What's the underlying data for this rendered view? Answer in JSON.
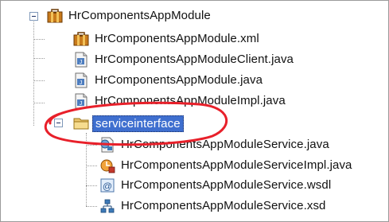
{
  "tree": {
    "root": {
      "label": "HrComponentsAppModule",
      "icon": "application-module-icon",
      "children": [
        {
          "label": "HrComponentsAppModule.xml",
          "icon": "application-module-icon"
        },
        {
          "label": "HrComponentsAppModuleClient.java",
          "icon": "java-file-icon"
        },
        {
          "label": "HrComponentsAppModule.java",
          "icon": "java-file-icon"
        },
        {
          "label": "HrComponentsAppModuleImpl.java",
          "icon": "java-file-icon"
        }
      ]
    },
    "folder": {
      "label": "serviceinterface",
      "icon": "folder-open-icon",
      "selected": true,
      "children": [
        {
          "label": "HrComponentsAppModuleService.java",
          "icon": "service-interface-icon"
        },
        {
          "label": "HrComponentsAppModuleServiceImpl.java",
          "icon": "service-impl-icon"
        },
        {
          "label": "HrComponentsAppModuleService.wsdl",
          "icon": "wsdl-file-icon"
        },
        {
          "label": "HrComponentsAppModuleService.xsd",
          "icon": "xsd-file-icon"
        }
      ]
    }
  },
  "colors": {
    "selection": "#3f6fcf",
    "highlight_ring": "#e8202a",
    "tree_lines": "#9a9a9a"
  }
}
